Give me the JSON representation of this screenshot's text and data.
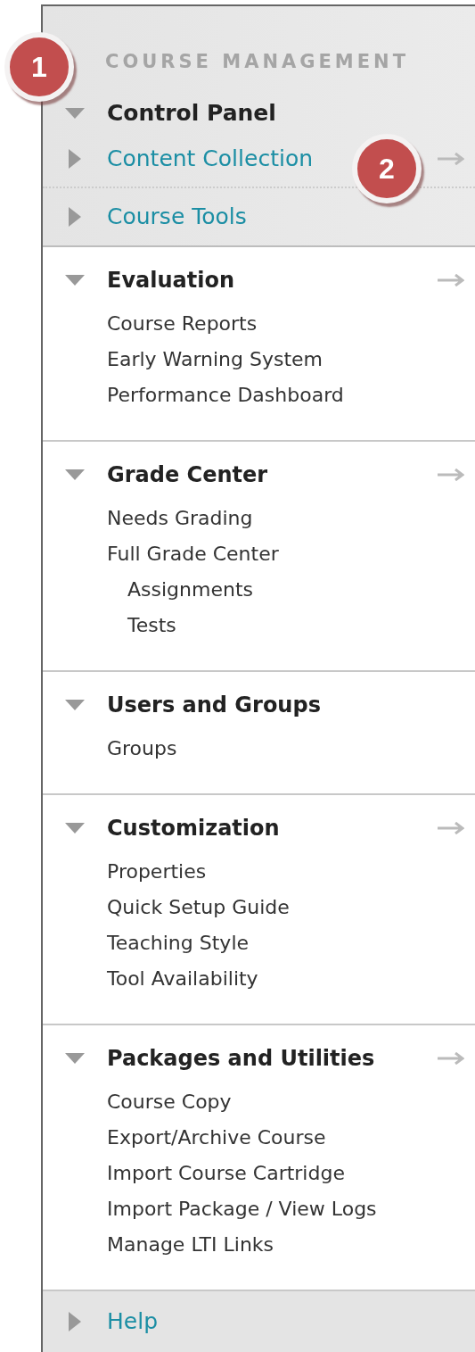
{
  "callouts": [
    "1",
    "2"
  ],
  "header": "COURSE MANAGEMENT",
  "control_panel": {
    "title": "Control Panel",
    "expanded": true,
    "items": [
      {
        "label": "Content Collection",
        "expanded": false,
        "has_arrow": true
      },
      {
        "label": "Course Tools",
        "expanded": false,
        "has_arrow": false
      }
    ]
  },
  "sections": [
    {
      "title": "Evaluation",
      "expanded": true,
      "has_arrow": true,
      "items": [
        {
          "label": "Course Reports"
        },
        {
          "label": "Early Warning System"
        },
        {
          "label": "Performance Dashboard"
        }
      ]
    },
    {
      "title": "Grade Center",
      "expanded": true,
      "has_arrow": true,
      "items": [
        {
          "label": "Needs Grading"
        },
        {
          "label": "Full Grade Center",
          "children": [
            {
              "label": "Assignments"
            },
            {
              "label": "Tests"
            }
          ]
        }
      ]
    },
    {
      "title": "Users and Groups",
      "expanded": true,
      "has_arrow": false,
      "items": [
        {
          "label": "Groups"
        }
      ]
    },
    {
      "title": "Customization",
      "expanded": true,
      "has_arrow": true,
      "items": [
        {
          "label": "Properties"
        },
        {
          "label": "Quick Setup Guide"
        },
        {
          "label": "Teaching Style"
        },
        {
          "label": "Tool Availability"
        }
      ]
    },
    {
      "title": "Packages and Utilities",
      "expanded": true,
      "has_arrow": true,
      "items": [
        {
          "label": "Course Copy"
        },
        {
          "label": "Export/Archive Course"
        },
        {
          "label": "Import Course Cartridge"
        },
        {
          "label": "Import Package / View Logs"
        },
        {
          "label": "Manage LTI Links"
        }
      ]
    }
  ],
  "help": {
    "label": "Help",
    "expanded": false
  }
}
